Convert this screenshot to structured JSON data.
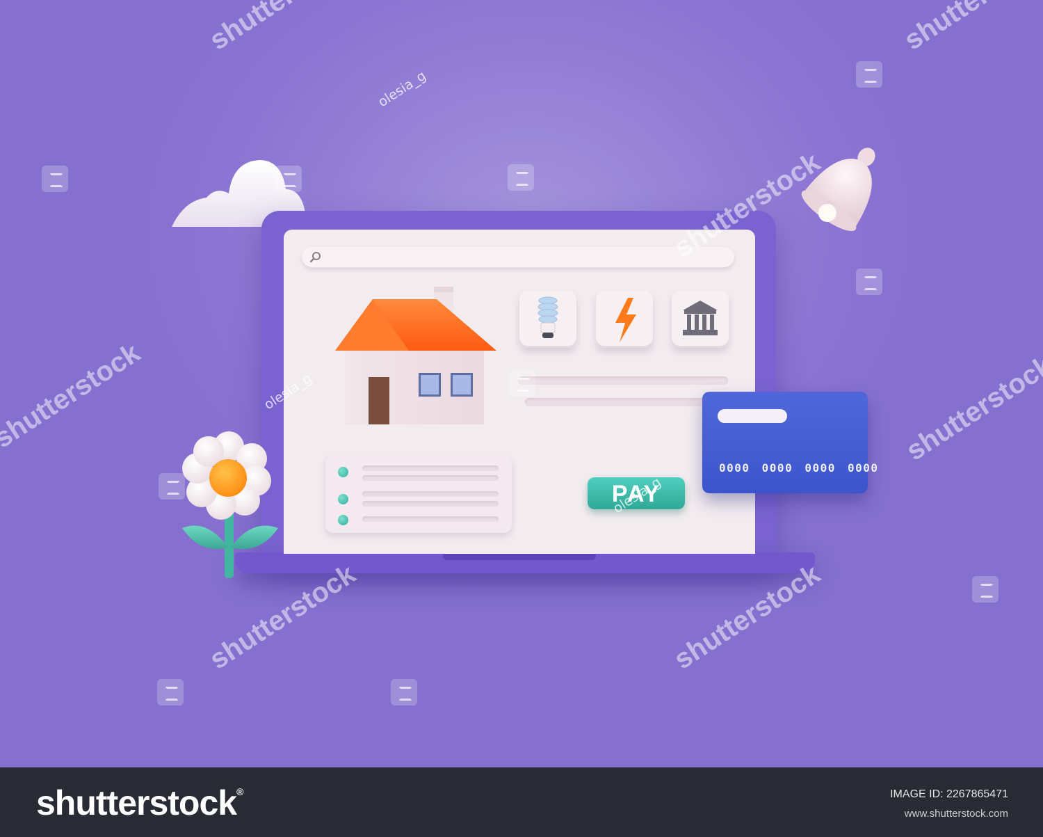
{
  "screen": {
    "pay_button_label": "PAY",
    "card_number": "0000 0000 0000 0000"
  },
  "icons": [
    "search-icon",
    "house-icon",
    "lightbulb-icon",
    "lightning-bolt-icon",
    "bank-icon",
    "credit-card-icon",
    "cloud-icon",
    "bell-icon",
    "flower-icon"
  ],
  "watermark": {
    "brand": "shutterstock",
    "contributor": "olesia_g"
  },
  "footer": {
    "logo": "shutterstock",
    "logo_mark": "®",
    "image_id": "IMAGE ID: 2267865471",
    "url": "www.shutterstock.com"
  },
  "colors": {
    "background": "#8a73d2",
    "laptop": "#7a63d0",
    "screen": "#f3ecef",
    "roof": "#ff6a1a",
    "pay_button": "#3bbfae",
    "card": "#4660d3",
    "footer": "#282b33"
  }
}
